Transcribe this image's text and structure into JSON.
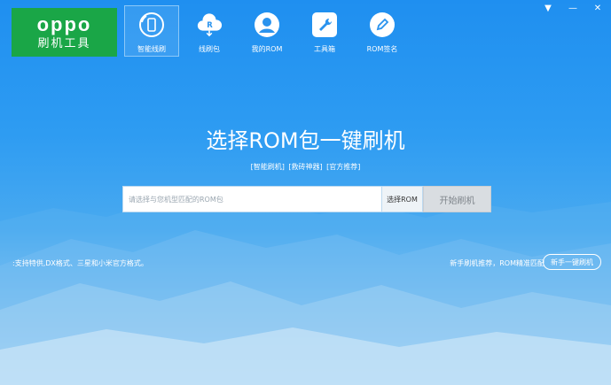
{
  "logo": {
    "brand": "oppo",
    "subtitle": "刷机工具"
  },
  "nav": [
    {
      "label": "智能线刷",
      "icon": "phone-refresh-icon",
      "active": true
    },
    {
      "label": "线刷包",
      "icon": "cloud-download-icon",
      "active": false
    },
    {
      "label": "我的ROM",
      "icon": "user-icon",
      "active": false
    },
    {
      "label": "工具箱",
      "icon": "wrench-icon",
      "active": false
    },
    {
      "label": "ROM签名",
      "icon": "pen-icon",
      "active": false
    }
  ],
  "window": {
    "menu_icon": "menu-icon",
    "minimize_icon": "minimize-icon",
    "close_icon": "close-icon"
  },
  "main": {
    "title": "选择ROM包一键刷机",
    "links": [
      "[智能刷机]",
      "[救砖神器]",
      "[官方推荐]"
    ],
    "search_placeholder": "请选择与您机型匹配的ROM包",
    "select_label": "选择ROM",
    "start_label": "开始刷机",
    "hint_left": ":支持特供,DX格式、三星和小米官方格式。",
    "hint_right": "新手刷机推荐，ROM精准匹配",
    "guide_label": "新手一键刷机"
  },
  "colors": {
    "logo_bg": "#1aa647",
    "bg_top": "#1f8ff0",
    "bg_bottom": "#d8ecf8"
  }
}
